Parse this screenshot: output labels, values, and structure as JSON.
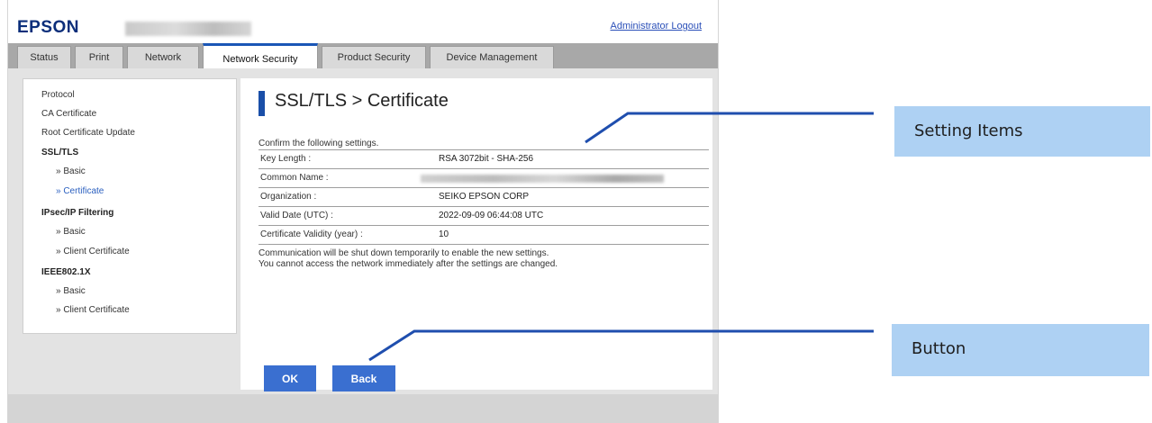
{
  "header": {
    "logo": "EPSON",
    "logout_link": "Administrator Logout"
  },
  "tabs": [
    {
      "label": "Status"
    },
    {
      "label": "Print"
    },
    {
      "label": "Network"
    },
    {
      "label": "Network Security",
      "active": true
    },
    {
      "label": "Product Security"
    },
    {
      "label": "Device Management"
    }
  ],
  "sidebar": {
    "items": [
      {
        "label": "Protocol"
      },
      {
        "label": "CA Certificate"
      },
      {
        "label": "Root Certificate Update"
      },
      {
        "label": "SSL/TLS"
      },
      {
        "label": "» Basic"
      },
      {
        "label": "» Certificate"
      },
      {
        "label": "IPsec/IP Filtering"
      },
      {
        "label": "» Basic"
      },
      {
        "label": "» Client Certificate"
      },
      {
        "label": "IEEE802.1X"
      },
      {
        "label": "» Basic"
      },
      {
        "label": "» Client Certificate"
      }
    ]
  },
  "main": {
    "title": "SSL/TLS > Certificate",
    "confirm_text": "Confirm the following settings.",
    "rows": [
      {
        "label": "Key Length :",
        "value": "RSA 3072bit - SHA-256"
      },
      {
        "label": "Common Name :",
        "value": ""
      },
      {
        "label": "Organization :",
        "value": "SEIKO EPSON CORP"
      },
      {
        "label": "Valid Date (UTC) :",
        "value": "2022-09-09 06:44:08 UTC"
      },
      {
        "label": "Certificate Validity (year) :",
        "value": "10"
      }
    ],
    "notes": [
      "Communication will be shut down temporarily to enable the new settings.",
      "You cannot access the network immediately after the settings are changed."
    ],
    "ok_label": "OK",
    "back_label": "Back"
  },
  "callouts": {
    "setting_items": "Setting Items",
    "button": "Button"
  },
  "colors": {
    "accent": "#1a56b6",
    "button": "#3a6fd0",
    "callout_bg": "#aed1f3",
    "leader_line": "#1f4eae"
  }
}
